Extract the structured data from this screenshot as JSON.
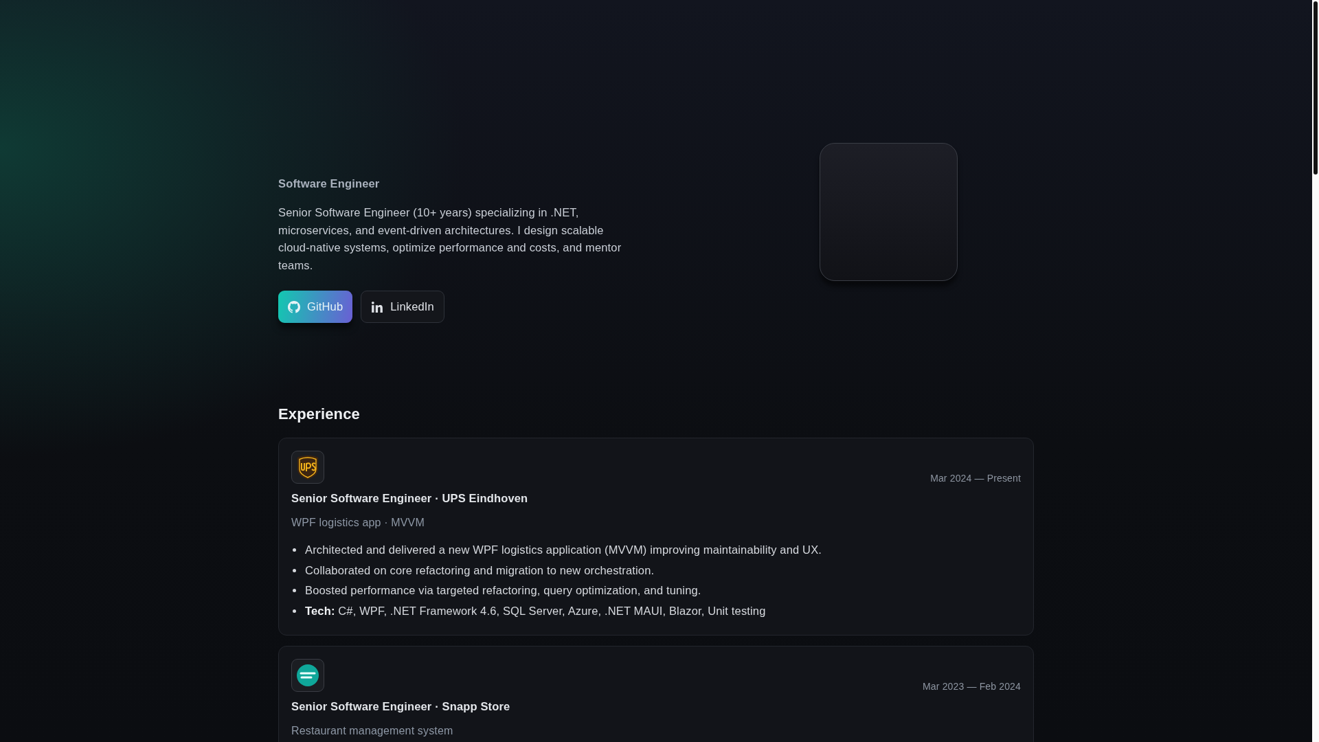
{
  "hero": {
    "role": "Software Engineer",
    "bio": "Senior Software Engineer (10+ years) specializing in .NET, microservices, and event-driven architectures. I design scalable cloud-native systems, optimize performance and costs, and mentor teams.",
    "links": [
      {
        "label": "GitHub",
        "kind": "github",
        "primary": true
      },
      {
        "label": "LinkedIn",
        "kind": "linkedin",
        "primary": false
      }
    ]
  },
  "experience": {
    "title": "Experience",
    "items": [
      {
        "kind": "ups",
        "title": "Senior Software Engineer · UPS Eindhoven",
        "dates": "Mar 2024 — Present",
        "summary": "WPF logistics app · MVVM",
        "bullets": [
          "Architected and delivered a new WPF logistics application (MVVM) improving maintainability and UX.",
          "Collaborated on core refactoring and migration to new orchestration.",
          "Boosted performance via targeted refactoring, query optimization, and tuning.",
          "**Tech:** C#, WPF, .NET Framework 4.6, SQL Server, Azure, .NET MAUI, Blazor, Unit testing"
        ]
      },
      {
        "kind": "snapp",
        "title": "Senior Software Engineer · Snapp Store",
        "dates": "Mar 2023 — Feb 2024",
        "summary": "Restaurant management system"
      }
    ]
  }
}
